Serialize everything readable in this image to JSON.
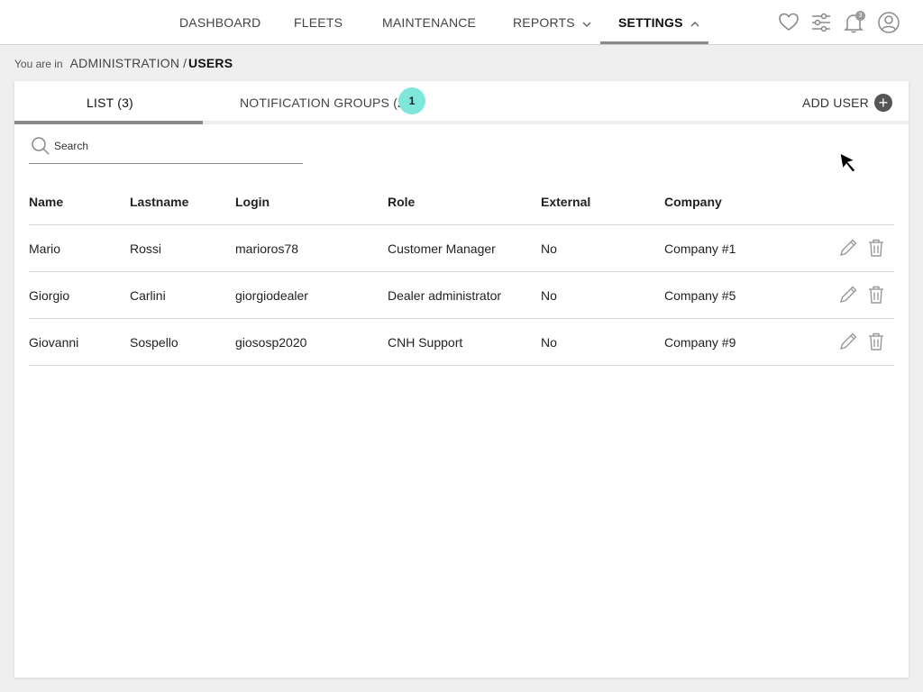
{
  "nav": {
    "items": [
      {
        "label": "DASHBOARD"
      },
      {
        "label": "FLEETS"
      },
      {
        "label": "MAINTENANCE"
      },
      {
        "label": "REPORTS"
      },
      {
        "label": "SETTINGS"
      }
    ],
    "notification_count": "3",
    "icons": [
      "heart-icon",
      "sliders-icon",
      "bell-icon",
      "user-icon"
    ]
  },
  "breadcrumb": {
    "prefix": "You are in",
    "section": "ADMINISTRATION",
    "separator": "/",
    "current": "USERS"
  },
  "tabs": {
    "list": "LIST (3)",
    "groups": "NOTIFICATION GROUPS (2)",
    "badge": "1",
    "add_user": "ADD USER"
  },
  "search": {
    "placeholder": "Search",
    "value": ""
  },
  "table": {
    "headers": [
      "Name",
      "Lastname",
      "Login",
      "Role",
      "External",
      "Company"
    ],
    "rows": [
      [
        "Mario",
        "Rossi",
        "marioros78",
        "Customer Manager",
        "No",
        "Company #1"
      ],
      [
        "Giorgio",
        "Carlini",
        "giorgiodealer",
        "Dealer administrator",
        "No",
        "Company #5"
      ],
      [
        "Giovanni",
        "Sospello",
        "giososp2020",
        "CNH Support",
        "No",
        "Company #9"
      ]
    ]
  },
  "colors": {
    "accent_teal": "#7fe6dc",
    "active_underline": "#8a8a8a",
    "page_bg": "#efefef"
  }
}
